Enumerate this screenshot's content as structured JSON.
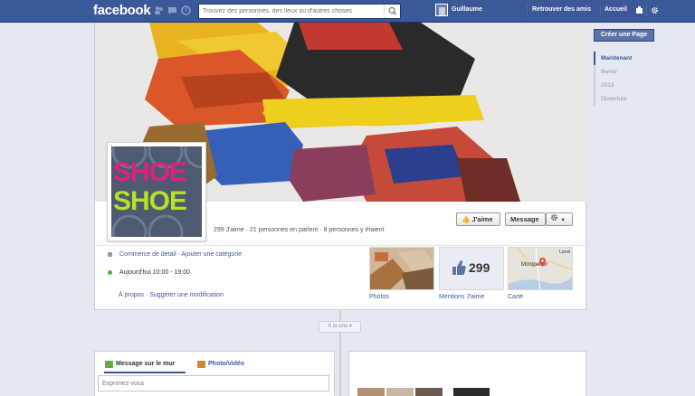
{
  "topbar": {
    "logo": "facebook",
    "search_placeholder": "Trouvez des personnes, des lieux ou d'autres choses",
    "user_name": "Guillaume",
    "find_friends": "Retrouver des amis",
    "home": "Accueil"
  },
  "page": {
    "stats": "299 J'aime · 21 personnes en parlent · 8 personnes y étaient",
    "like_button": "J'aime",
    "message_button": "Message",
    "category": "Commerce de détail · Ajouter une catégorie",
    "hours": "Aujourd'hui 10:00 - 19:00",
    "about_links": "À propos · Suggérer une modification",
    "profile_text": [
      "SHOE",
      "SHOE"
    ]
  },
  "tiles": [
    {
      "label": "Photos"
    },
    {
      "label": "Mentions J'aime",
      "count": "299"
    },
    {
      "label": "Carte",
      "map_top": "Lunel",
      "map_city": "Montpellier"
    }
  ],
  "timeline": {
    "alaune": "À la une ▾"
  },
  "composer": {
    "tab_status": "Message sur le mur",
    "tab_photo": "Photo/vidéo",
    "placeholder": "Exprimez-vous"
  },
  "sidebar": {
    "create_page": "Créer une Page",
    "items": [
      "Maintenant",
      "février",
      "2013",
      "Ouverture"
    ]
  },
  "colors": {
    "brand": "#3b5998",
    "background": "#e5e8ef"
  }
}
